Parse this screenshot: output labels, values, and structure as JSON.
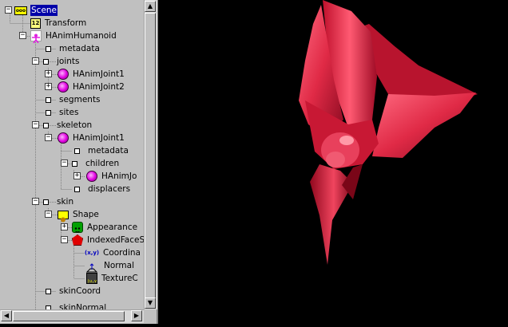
{
  "tree": {
    "nodes": [
      {
        "label": "Scene",
        "icon": "scene-icon",
        "selected": true
      },
      {
        "label": "Transform",
        "icon": "transform-icon"
      },
      {
        "label": "HAnimHumanoid",
        "icon": "humanoid-icon"
      },
      {
        "label": "metadata",
        "icon": "field-icon"
      },
      {
        "label": "joints",
        "icon": "field-icon"
      },
      {
        "label": "HAnimJoint1",
        "icon": "joint-icon"
      },
      {
        "label": "HAnimJoint2",
        "icon": "joint-icon"
      },
      {
        "label": "segments",
        "icon": "field-icon"
      },
      {
        "label": "sites",
        "icon": "field-icon"
      },
      {
        "label": "skeleton",
        "icon": "field-icon"
      },
      {
        "label": "HAnimJoint1",
        "icon": "joint-icon"
      },
      {
        "label": "metadata",
        "icon": "field-icon"
      },
      {
        "label": "children",
        "icon": "field-icon"
      },
      {
        "label": "HAnimJo",
        "icon": "joint-icon"
      },
      {
        "label": "displacers",
        "icon": "field-icon"
      },
      {
        "label": "skin",
        "icon": "field-icon"
      },
      {
        "label": "Shape",
        "icon": "shape-icon"
      },
      {
        "label": "Appearance",
        "icon": "appearance-icon"
      },
      {
        "label": "IndexedFaceS",
        "icon": "indexed-face-set-icon"
      },
      {
        "label": "Coordina",
        "icon": "coordinate-icon"
      },
      {
        "label": "Normal",
        "icon": "normal-icon"
      },
      {
        "label": "TextureC",
        "icon": "texture-coordinate-icon"
      },
      {
        "label": "skinCoord",
        "icon": "field-icon"
      },
      {
        "label": "skinNormal",
        "icon": "field-icon"
      }
    ]
  },
  "viewport": {
    "background": "#000000",
    "model_color": "#e0304a"
  }
}
